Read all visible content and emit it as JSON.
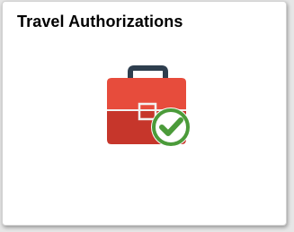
{
  "tile": {
    "title": "Travel Authorizations",
    "icon": "briefcase-check-icon"
  },
  "colors": {
    "briefcase_top": "#e74c3c",
    "briefcase_bottom": "#c6362b",
    "handle": "#2e3e4e",
    "check_ring": "#4b9b3a",
    "check_mark": "#4b9b3a",
    "badge_fill": "#ffffff"
  }
}
